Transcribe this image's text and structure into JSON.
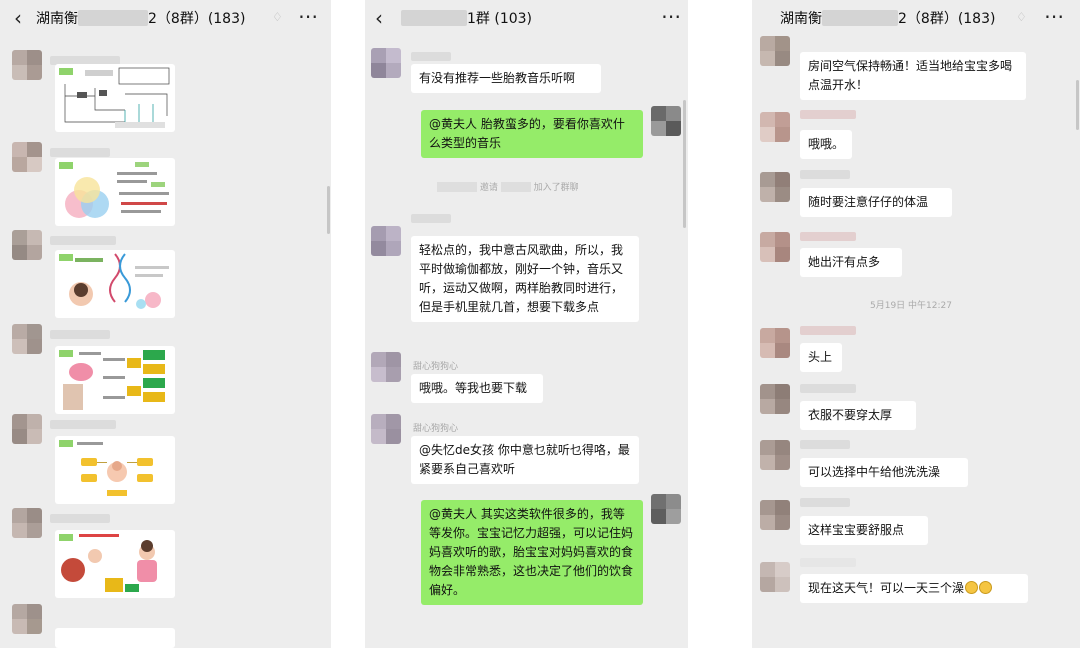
{
  "panel1": {
    "title_prefix": "湖南衡",
    "title_suffix": "2（8群）(183)",
    "icons": [
      "back-arrow-icon",
      "mute-bell-icon",
      "more-dots-icon"
    ],
    "image_messages": [
      {
        "name": "flowchart-diagram-image"
      },
      {
        "name": "venn-diagram-image"
      },
      {
        "name": "dna-baby-infographic-image"
      },
      {
        "name": "digestive-system-infographic-image"
      },
      {
        "name": "baby-nutrition-infographic-image"
      },
      {
        "name": "baby-feeding-infographic-image"
      }
    ]
  },
  "panel2": {
    "title_suffix": "1群 (103)",
    "icons": [
      "back-arrow-icon",
      "more-dots-icon"
    ],
    "messages": [
      {
        "side": "left",
        "text": "有没有推荐一些胎教音乐听啊"
      },
      {
        "side": "right",
        "text": "@黄夫人 胎教蛮多的，要看你喜欢什么类型的音乐"
      },
      {
        "side": "left",
        "text": "轻松点的，我中意古风歌曲，所以，我平时做瑜伽都放，刚好一个钟，音乐又听，运动又做啊，两样胎教同时进行，但是手机里就几首，想要下载多点"
      },
      {
        "side": "left",
        "nickname": "甜心狗狗心",
        "text": "哦哦。等我也要下载"
      },
      {
        "side": "left",
        "nickname": "甜心狗狗心",
        "text": "@失忆de女孩 你中意乜就听乜得咯，最紧要系自己喜欢听"
      },
      {
        "side": "right",
        "text": "@黄夫人 其实这类软件很多的，我等等发你。宝宝记忆力超强，可以记住妈妈喜欢听的歌，胎宝宝对妈妈喜欢的食物会非常熟悉，这也决定了他们的饮食偏好。"
      }
    ],
    "system_notice": {
      "verb": "邀请",
      "suffix": "加入了群聊"
    }
  },
  "panel3": {
    "title_prefix": "湖南衡",
    "title_suffix": "2（8群）(183)",
    "icons": [
      "mute-bell-icon",
      "more-dots-icon"
    ],
    "messages_before": [
      {
        "text": "房间空气保持畅通！适当地给宝宝多喝点温开水！"
      },
      {
        "text": "哦哦。"
      },
      {
        "text": "随时要注意仔仔的体温"
      },
      {
        "text": "她出汗有点多"
      }
    ],
    "timestamp": "5月19日 中午12:27",
    "messages_after": [
      {
        "text": "头上"
      },
      {
        "text": "衣服不要穿太厚"
      },
      {
        "text": "可以选择中午给他洗洗澡"
      },
      {
        "text": "这样宝宝要舒服点"
      },
      {
        "text": "现在这天气！可以一天三个澡",
        "emoji_count": 2
      }
    ]
  },
  "colors": {
    "chat_bg": "#ededed",
    "bubble_self": "#95ec69",
    "bubble_other": "#ffffff"
  }
}
